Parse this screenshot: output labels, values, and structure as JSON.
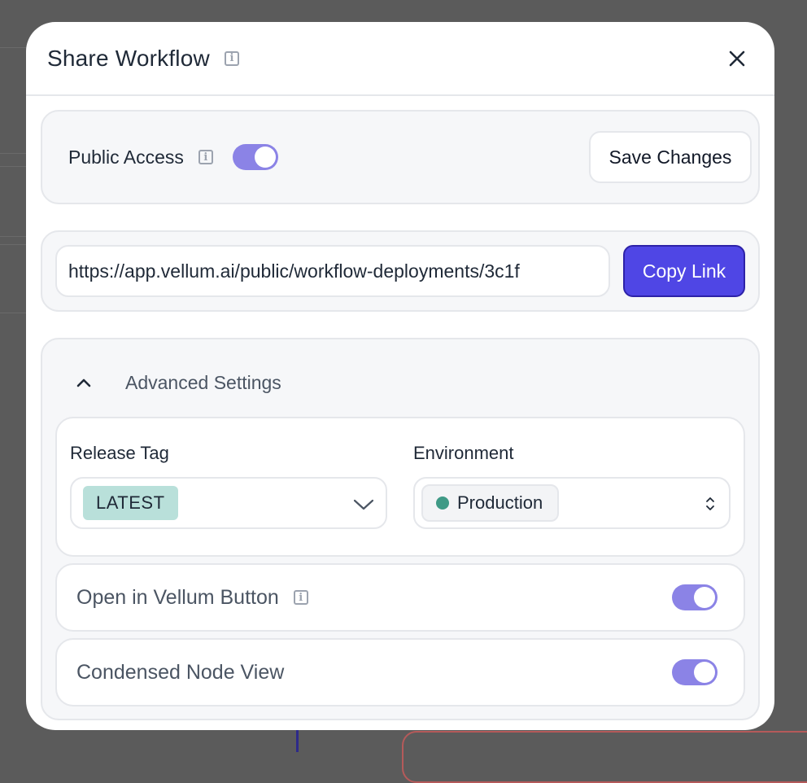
{
  "modal": {
    "title": "Share Workflow"
  },
  "public_access": {
    "label": "Public Access",
    "enabled": true,
    "save_label": "Save Changes"
  },
  "link": {
    "url": "https://app.vellum.ai/public/workflow-deployments/3c1f",
    "copy_label": "Copy Link"
  },
  "advanced": {
    "title": "Advanced Settings",
    "expanded": true,
    "release_tag": {
      "label": "Release Tag",
      "value": "LATEST"
    },
    "environment": {
      "label": "Environment",
      "value": "Production",
      "dot_color": "#3f9a86"
    },
    "open_in_vellum": {
      "label": "Open in Vellum Button",
      "enabled": true
    },
    "condensed_node_view": {
      "label": "Condensed Node View",
      "enabled": true
    }
  },
  "colors": {
    "accent": "#4f46e5",
    "toggle_on": "#8b83e6",
    "tag_bg": "#b9e0da"
  }
}
